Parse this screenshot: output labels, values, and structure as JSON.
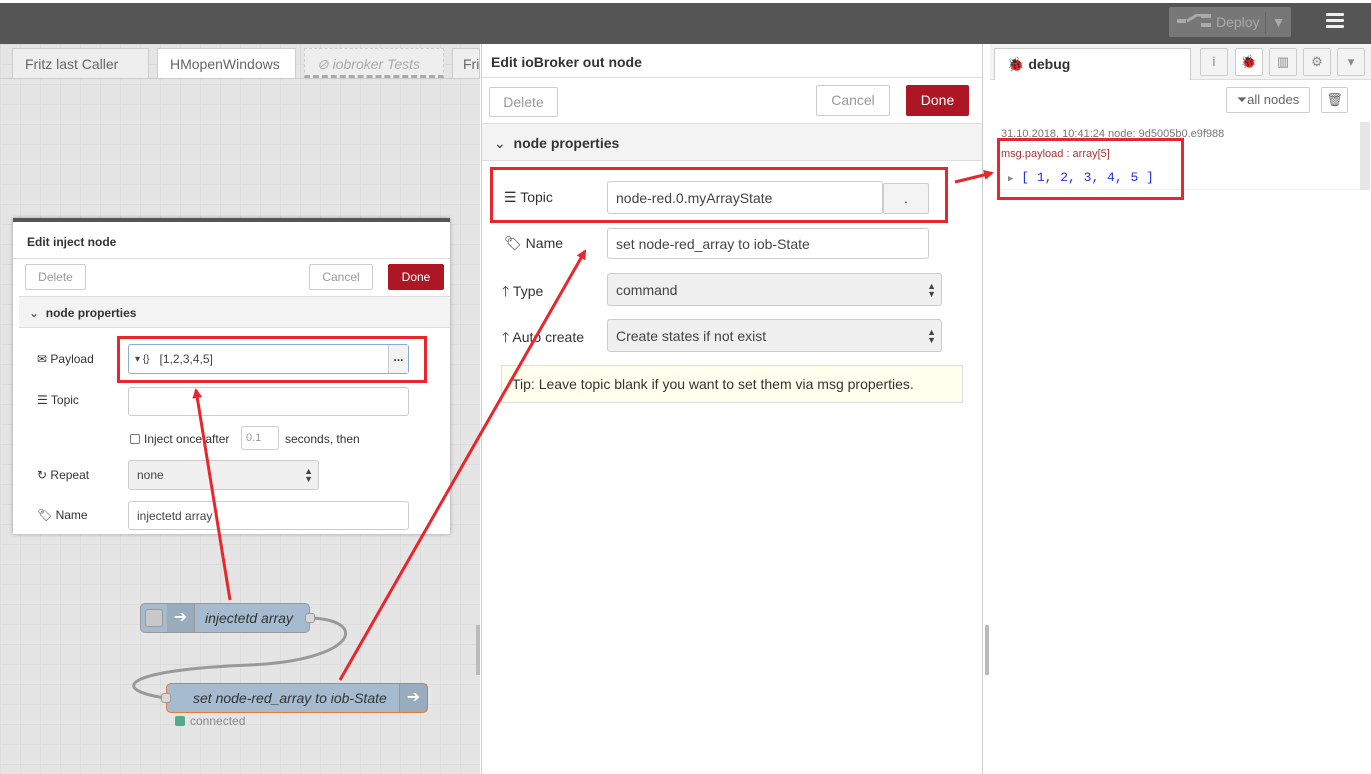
{
  "header": {
    "deploy_label": "Deploy",
    "colors": {
      "bar": "#555555",
      "accent": "#ad1625",
      "annotation": "#e8262b"
    }
  },
  "workspace_tabs": [
    "Fritz last Caller",
    "HMopenWindows",
    "iobroker Tests",
    "Fri"
  ],
  "inject_dialog": {
    "title": "Edit inject node",
    "delete_label": "Delete",
    "cancel_label": "Cancel",
    "done_label": "Done",
    "section": "node properties",
    "payload_label": "Payload",
    "payload_type": "{}",
    "payload_value": "[1,2,3,4,5]",
    "payload_more": "...",
    "topic_label": "Topic",
    "topic_value": "",
    "inject_once_label": "Inject once after",
    "inject_once_value": "0.1",
    "inject_once_suffix": "seconds, then",
    "repeat_label": "Repeat",
    "repeat_value": "none",
    "name_label": "Name",
    "name_value": "injectetd array"
  },
  "flow": {
    "inject_node_label": "injectetd array",
    "out_node_label": "set node-red_array to iob-State",
    "status_text": "connected"
  },
  "editor": {
    "title": "Edit ioBroker out node",
    "delete_label": "Delete",
    "cancel_label": "Cancel",
    "done_label": "Done",
    "section": "node properties",
    "topic_label": "Topic",
    "topic_value": "node-red.0.myArrayState",
    "topic_btn": ".",
    "name_label": "Name",
    "name_value": "set node-red_array to iob-State",
    "type_label": "Type",
    "type_value": "command",
    "autocreate_label": "Auto create",
    "autocreate_value": "Create states if not exist",
    "tip": "Tip: Leave topic blank if you want to set them via msg properties."
  },
  "debug": {
    "tab_label": "debug",
    "filter_label": "all nodes",
    "msg_meta": "31.10.2018, 10:41:24   node: 9d5005b0.e9f988",
    "msg_topic": "msg.payload : array[5]",
    "msg_value": "[ 1, 2, 3, 4, 5 ]"
  }
}
